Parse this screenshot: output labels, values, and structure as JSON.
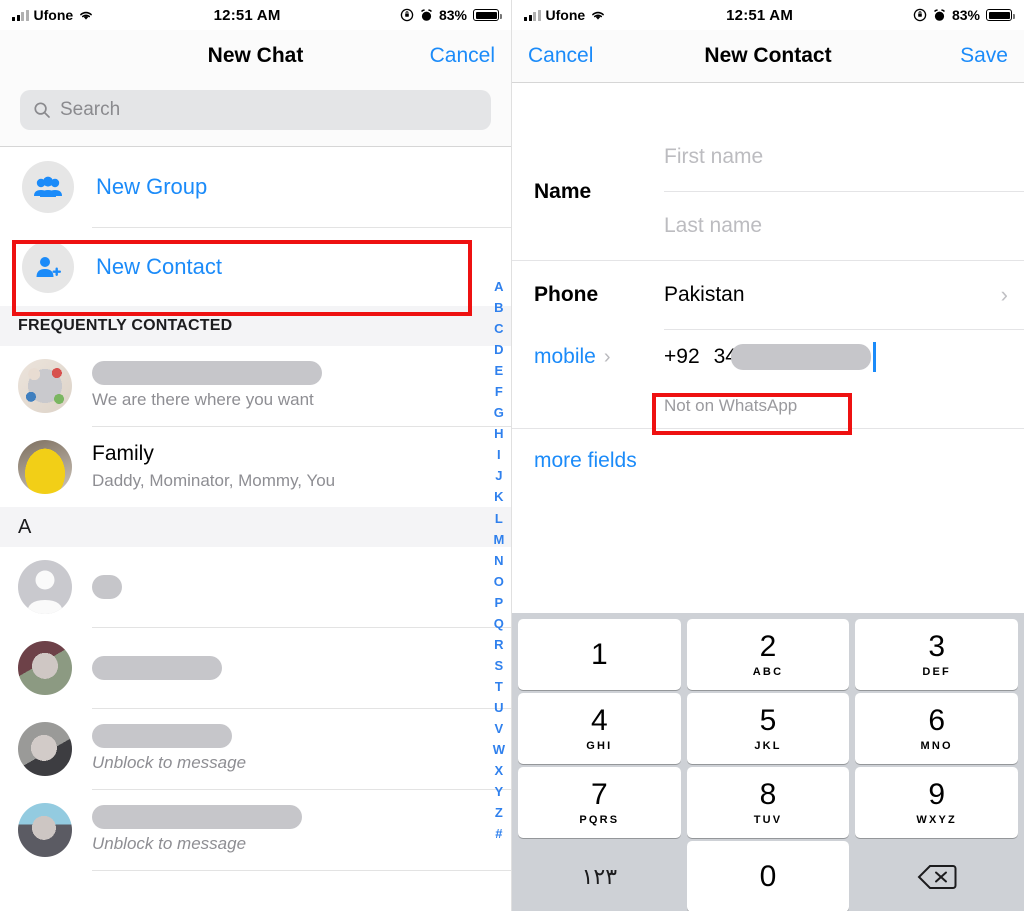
{
  "status_bar": {
    "carrier": "Ufone",
    "time": "12:51 AM",
    "battery_pct": "83%",
    "icons": [
      "signal-bars-icon",
      "wifi-icon",
      "rotation-lock-icon",
      "alarm-clock-icon",
      "battery-icon"
    ]
  },
  "left_panel": {
    "nav": {
      "title": "New Chat",
      "cancel_label": "Cancel"
    },
    "search": {
      "placeholder": "Search"
    },
    "actions": [
      {
        "label": "New Group",
        "icon": "group-people-icon",
        "highlighted": false
      },
      {
        "label": "New Contact",
        "icon": "person-add-icon",
        "highlighted": true
      }
    ],
    "sections": [
      {
        "header": "FREQUENTLY CONTACTED",
        "rows": [
          {
            "name": "",
            "name_redacted": true,
            "subtitle": "We are there where you want",
            "avatar": "collage-avatar",
            "redact_width": 230
          },
          {
            "name": "Family",
            "name_redacted": false,
            "subtitle": "Daddy, Mominator, Mommy, You",
            "avatar": "yellow-car-avatar",
            "redact_width": 0
          }
        ]
      },
      {
        "header": "A",
        "rows": [
          {
            "name": "",
            "name_redacted": true,
            "subtitle": "",
            "avatar": "default-person-avatar",
            "redact_width": 30
          },
          {
            "name": "",
            "name_redacted": true,
            "subtitle": "",
            "avatar": "photo-avatar-1",
            "redact_width": 130
          },
          {
            "name": "",
            "name_redacted": true,
            "subtitle": "Unblock to message",
            "avatar": "photo-avatar-2",
            "redact_width": 140
          },
          {
            "name": "",
            "name_redacted": true,
            "subtitle": "Unblock to message",
            "avatar": "photo-avatar-3",
            "redact_width": 210
          }
        ]
      }
    ],
    "index_letters": [
      "A",
      "B",
      "C",
      "D",
      "E",
      "F",
      "G",
      "H",
      "I",
      "J",
      "K",
      "L",
      "M",
      "N",
      "O",
      "P",
      "Q",
      "R",
      "S",
      "T",
      "U",
      "V",
      "W",
      "X",
      "Y",
      "Z",
      "#"
    ]
  },
  "right_panel": {
    "nav": {
      "cancel_label": "Cancel",
      "title": "New Contact",
      "save_label": "Save"
    },
    "form": {
      "name_label": "Name",
      "first_name_placeholder": "First name",
      "last_name_placeholder": "Last name",
      "phone_label": "Phone",
      "country_value": "Pakistan",
      "mobile_label": "mobile",
      "country_code": "+92",
      "number_typed": "34",
      "not_on_whatsapp": "Not on WhatsApp",
      "more_fields_label": "more fields"
    }
  },
  "keypad": {
    "keys": [
      {
        "num": "1",
        "letters": ""
      },
      {
        "num": "2",
        "letters": "ABC"
      },
      {
        "num": "3",
        "letters": "DEF"
      },
      {
        "num": "4",
        "letters": "GHI"
      },
      {
        "num": "5",
        "letters": "JKL"
      },
      {
        "num": "6",
        "letters": "MNO"
      },
      {
        "num": "7",
        "letters": "PQRS"
      },
      {
        "num": "8",
        "letters": "TUV"
      },
      {
        "num": "9",
        "letters": "WXYZ"
      },
      {
        "num": "0",
        "letters": ""
      }
    ],
    "arabic_digits_key": "١٢٣",
    "delete_key": "delete-backspace-icon"
  },
  "colors": {
    "accent_blue": "#1b8bf9",
    "highlight_red": "#ee1111",
    "keypad_bg": "#ced1d6",
    "redact_gray": "#c6c6ca"
  }
}
